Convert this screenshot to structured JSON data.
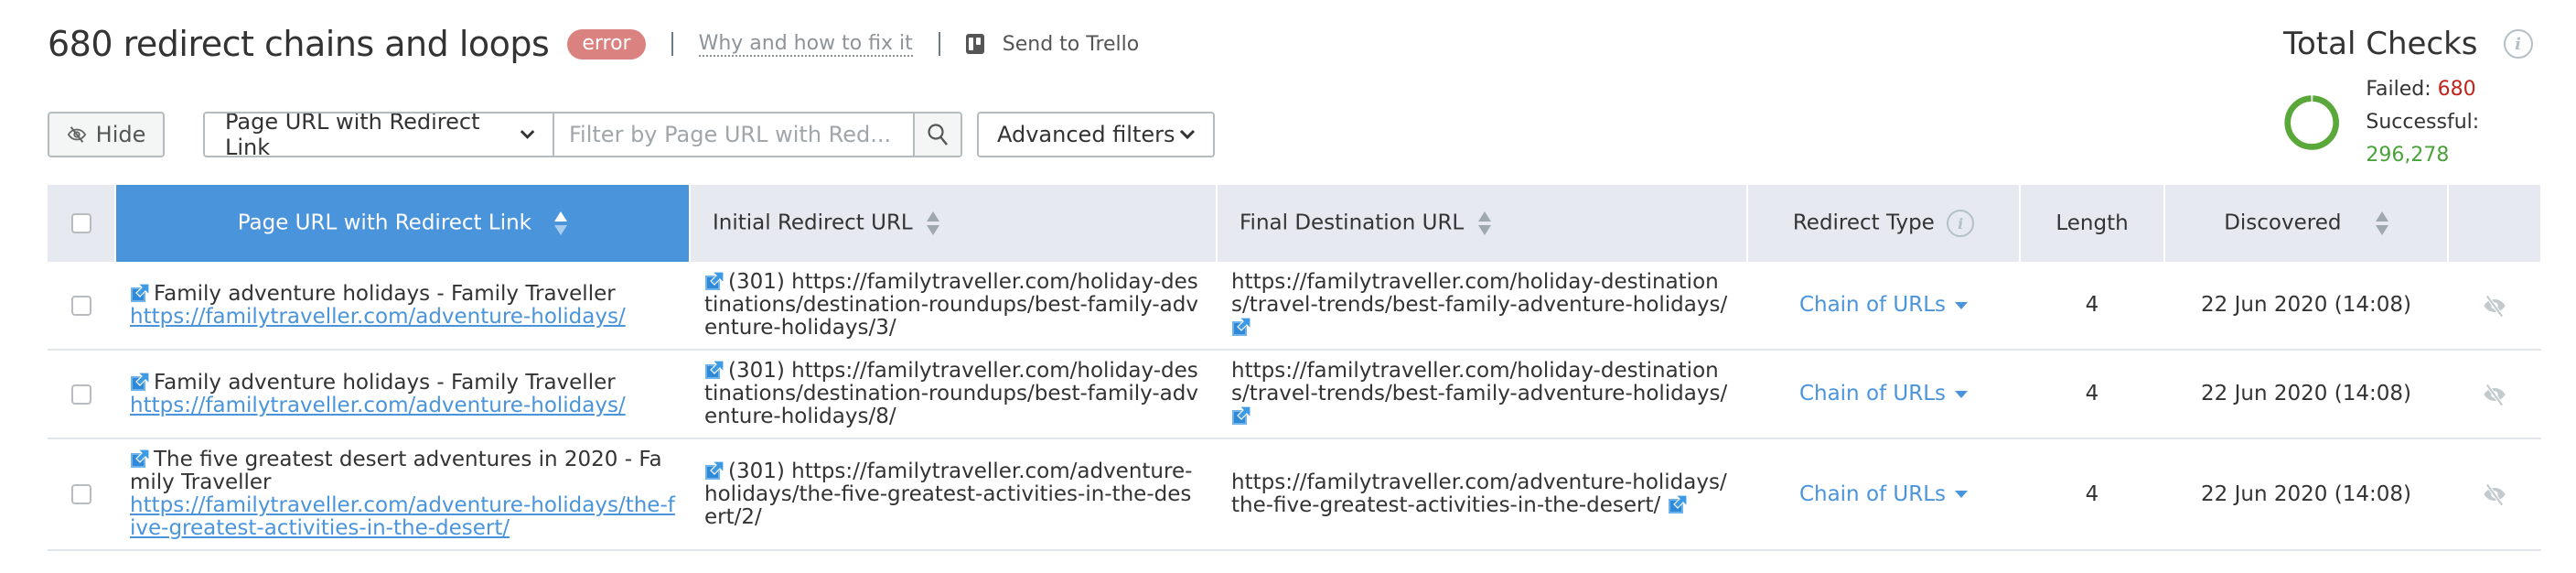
{
  "header": {
    "title": "680 redirect chains and loops",
    "badge": "error",
    "why_link": "Why and how to fix it",
    "trello": "Send to Trello"
  },
  "toolbar": {
    "hide_label": "Hide",
    "filter_column": "Page URL with Redirect Link",
    "filter_placeholder": "Filter by Page URL with Red...",
    "advanced_label": "Advanced filters"
  },
  "total_checks": {
    "title": "Total Checks",
    "failed_label": "Failed:",
    "failed_value": "680",
    "success_label": "Successful:",
    "success_value": "296,278",
    "colors": {
      "failed": "#c0241d",
      "success": "#4aa33a"
    }
  },
  "table": {
    "columns": {
      "page_url": "Page URL with Redirect Link",
      "initial": "Initial Redirect URL",
      "final": "Final Destination URL",
      "type": "Redirect Type",
      "length": "Length",
      "discovered": "Discovered"
    },
    "rows": [
      {
        "page_title": "Family adventure holidays - Family Traveller",
        "page_url": "https://familytraveller.com/adventure-holidays/",
        "initial": "(301) https://familytraveller.com/holiday-destinations/destination-roundups/best-family-adventure-holidays/3/",
        "final": "https://familytraveller.com/holiday-destinations/travel-trends/best-family-adventure-holidays/",
        "type": "Chain of URLs",
        "length": "4",
        "discovered": "22 Jun 2020 (14:08)"
      },
      {
        "page_title": "Family adventure holidays - Family Traveller",
        "page_url": "https://familytraveller.com/adventure-holidays/",
        "initial": "(301) https://familytraveller.com/holiday-destinations/destination-roundups/best-family-adventure-holidays/8/",
        "final": "https://familytraveller.com/holiday-destinations/travel-trends/best-family-adventure-holidays/",
        "type": "Chain of URLs",
        "length": "4",
        "discovered": "22 Jun 2020 (14:08)"
      },
      {
        "page_title": "The five greatest desert adventures in 2020 - Family Traveller",
        "page_url": "https://familytraveller.com/adventure-holidays/the-five-greatest-activities-in-the-desert/",
        "initial": "(301) https://familytraveller.com/adventure-holidays/the-five-greatest-activities-in-the-desert/2/",
        "final": "https://familytraveller.com/adventure-holidays/the-five-greatest-activities-in-the-desert/",
        "type": "Chain of URLs",
        "length": "4",
        "discovered": "22 Jun 2020 (14:08)"
      }
    ]
  },
  "colors": {
    "accent": "#4a94dc",
    "header_bg": "#e6eaf0",
    "badge_error": "#d9827f"
  }
}
